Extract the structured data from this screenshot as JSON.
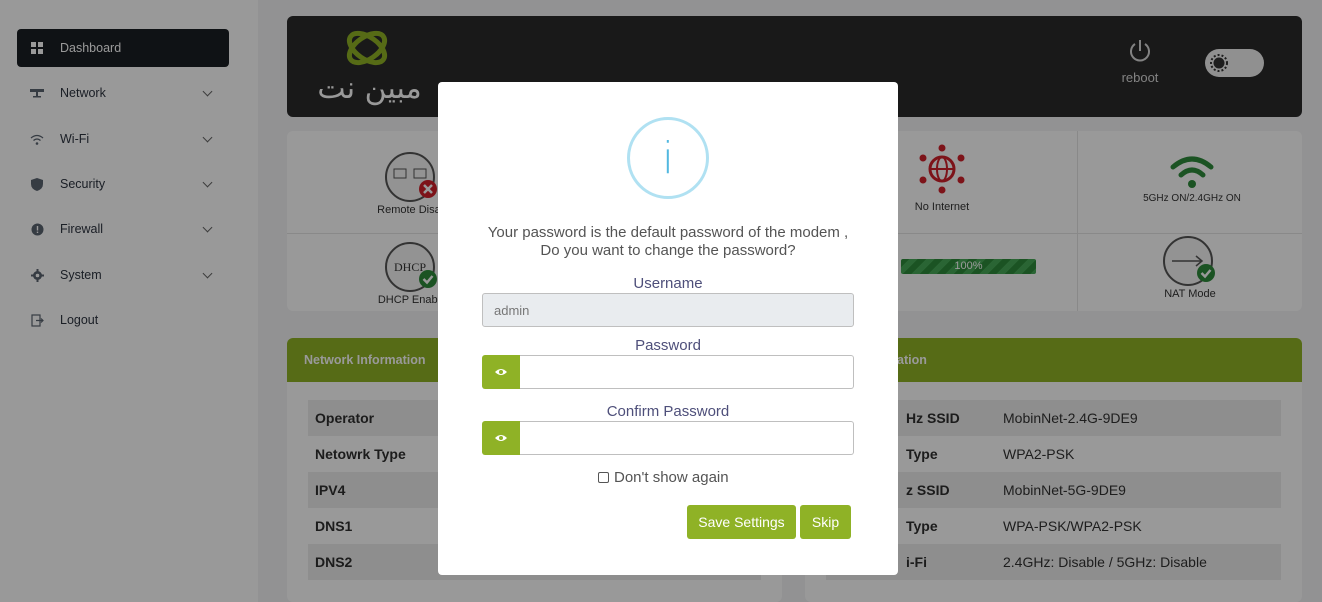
{
  "sidebar": {
    "items": [
      {
        "label": "Dashboard",
        "icon": "grid-icon",
        "active": true
      },
      {
        "label": "Network",
        "icon": "network-icon"
      },
      {
        "label": "Wi-Fi",
        "icon": "wifi-icon"
      },
      {
        "label": "Security",
        "icon": "shield-icon"
      },
      {
        "label": "Firewall",
        "icon": "firewall-icon"
      },
      {
        "label": "System",
        "icon": "gear-icon"
      },
      {
        "label": "Logout",
        "icon": "logout-icon"
      }
    ]
  },
  "header": {
    "brand_text": "مبین نت",
    "reboot_label": "reboot"
  },
  "status_cards": {
    "remote": "Remote Disab",
    "dhcp": "DHCP Enable",
    "internet": "No Internet",
    "wifi": "5GHz ON/2.4GHz ON",
    "signal": "100%",
    "nat": "NAT Mode",
    "dhcp_icon_text": "DHCP"
  },
  "network_info": {
    "title": "Network Information",
    "rows": [
      {
        "key": "Operator"
      },
      {
        "key": "Netowrk Type"
      },
      {
        "key": "IPV4"
      },
      {
        "key": "DNS1"
      },
      {
        "key": "DNS2"
      }
    ]
  },
  "wifi_info": {
    "title": "ation",
    "rows": [
      {
        "key": "Hz SSID",
        "value": "MobinNet-2.4G-9DE9"
      },
      {
        "key": "Type",
        "value": "WPA2-PSK"
      },
      {
        "key": "z SSID",
        "value": "MobinNet-5G-9DE9"
      },
      {
        "key": "Type",
        "value": "WPA-PSK/WPA2-PSK"
      },
      {
        "key": "i-Fi",
        "value": "2.4GHz: Disable / 5GHz: Disable"
      }
    ]
  },
  "modal": {
    "icon_glyph": "i",
    "message": "Your password is the default password of the modem , Do you want to change the password?",
    "username_label": "Username",
    "username_value": "admin",
    "password_label": "Password",
    "password_value": "",
    "confirm_label": "Confirm Password",
    "confirm_value": "",
    "dont_show_label": "Don't show again",
    "save_label": "Save Settings",
    "skip_label": "Skip"
  },
  "colors": {
    "accent": "#8fb226",
    "header_bg": "#2b2b2b",
    "error": "#d0202b",
    "ok": "#2e8b3b",
    "info": "#52b8e0"
  }
}
